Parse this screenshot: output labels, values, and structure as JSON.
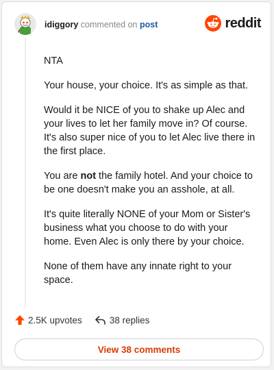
{
  "header": {
    "username": "idiggory",
    "commented_on": "commented on",
    "post_link": "post",
    "avatar_icon": "snoo-avatar-icon",
    "brand": "reddit",
    "brand_icon": "reddit-snoo-icon",
    "brand_color": "#ff4500"
  },
  "comment": {
    "p1": "NTA",
    "p2": "Your house, your choice. It's as simple as that.",
    "p3": "Would it be NICE of you to shake up Alec and your lives to let her family move in? Of course. It's also super nice of you to let Alec live there in the first place.",
    "p4_before": "You are ",
    "p4_bold": "not",
    "p4_after": " the family hotel. And your choice to be one doesn't make you an asshole, at all.",
    "p5": "It's quite literally NONE of your Mom or Sister's business what you choose to do with your home. Even Alec is only there by your choice.",
    "p6": "None of them have any innate right to your space."
  },
  "footer": {
    "upvotes": "2.5K upvotes",
    "upvote_icon": "upvote-arrow-icon",
    "replies": "38 replies",
    "reply_icon": "reply-arrow-icon",
    "accent_color": "#ff4500"
  },
  "view_comments": "View 38 comments"
}
